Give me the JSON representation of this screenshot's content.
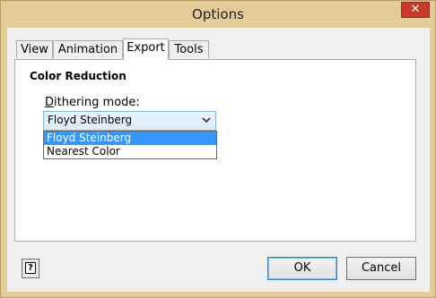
{
  "window": {
    "title": "Options",
    "close_glyph": "✕"
  },
  "tabs": [
    {
      "label": "View",
      "selected": false
    },
    {
      "label": "Animation",
      "selected": false
    },
    {
      "label": "Export",
      "selected": true
    },
    {
      "label": "Tools",
      "selected": false
    }
  ],
  "export": {
    "section_title": "Color Reduction",
    "dithering": {
      "label_mnemonic": "D",
      "label_rest": "ithering mode:",
      "selected_value": "Floyd Steinberg",
      "options": [
        "Floyd Steinberg",
        "Nearest Color"
      ]
    }
  },
  "buttons": {
    "ok": "OK",
    "cancel": "Cancel",
    "help_glyph": "?"
  },
  "icons": {
    "close": "close-icon",
    "help": "help-icon",
    "dropdown": "chevron-down-icon"
  },
  "colors": {
    "title_bar": "#e3cc98",
    "close_button": "#c7392d",
    "selection": "#3399ff",
    "combo_border": "#7eb4ea"
  }
}
